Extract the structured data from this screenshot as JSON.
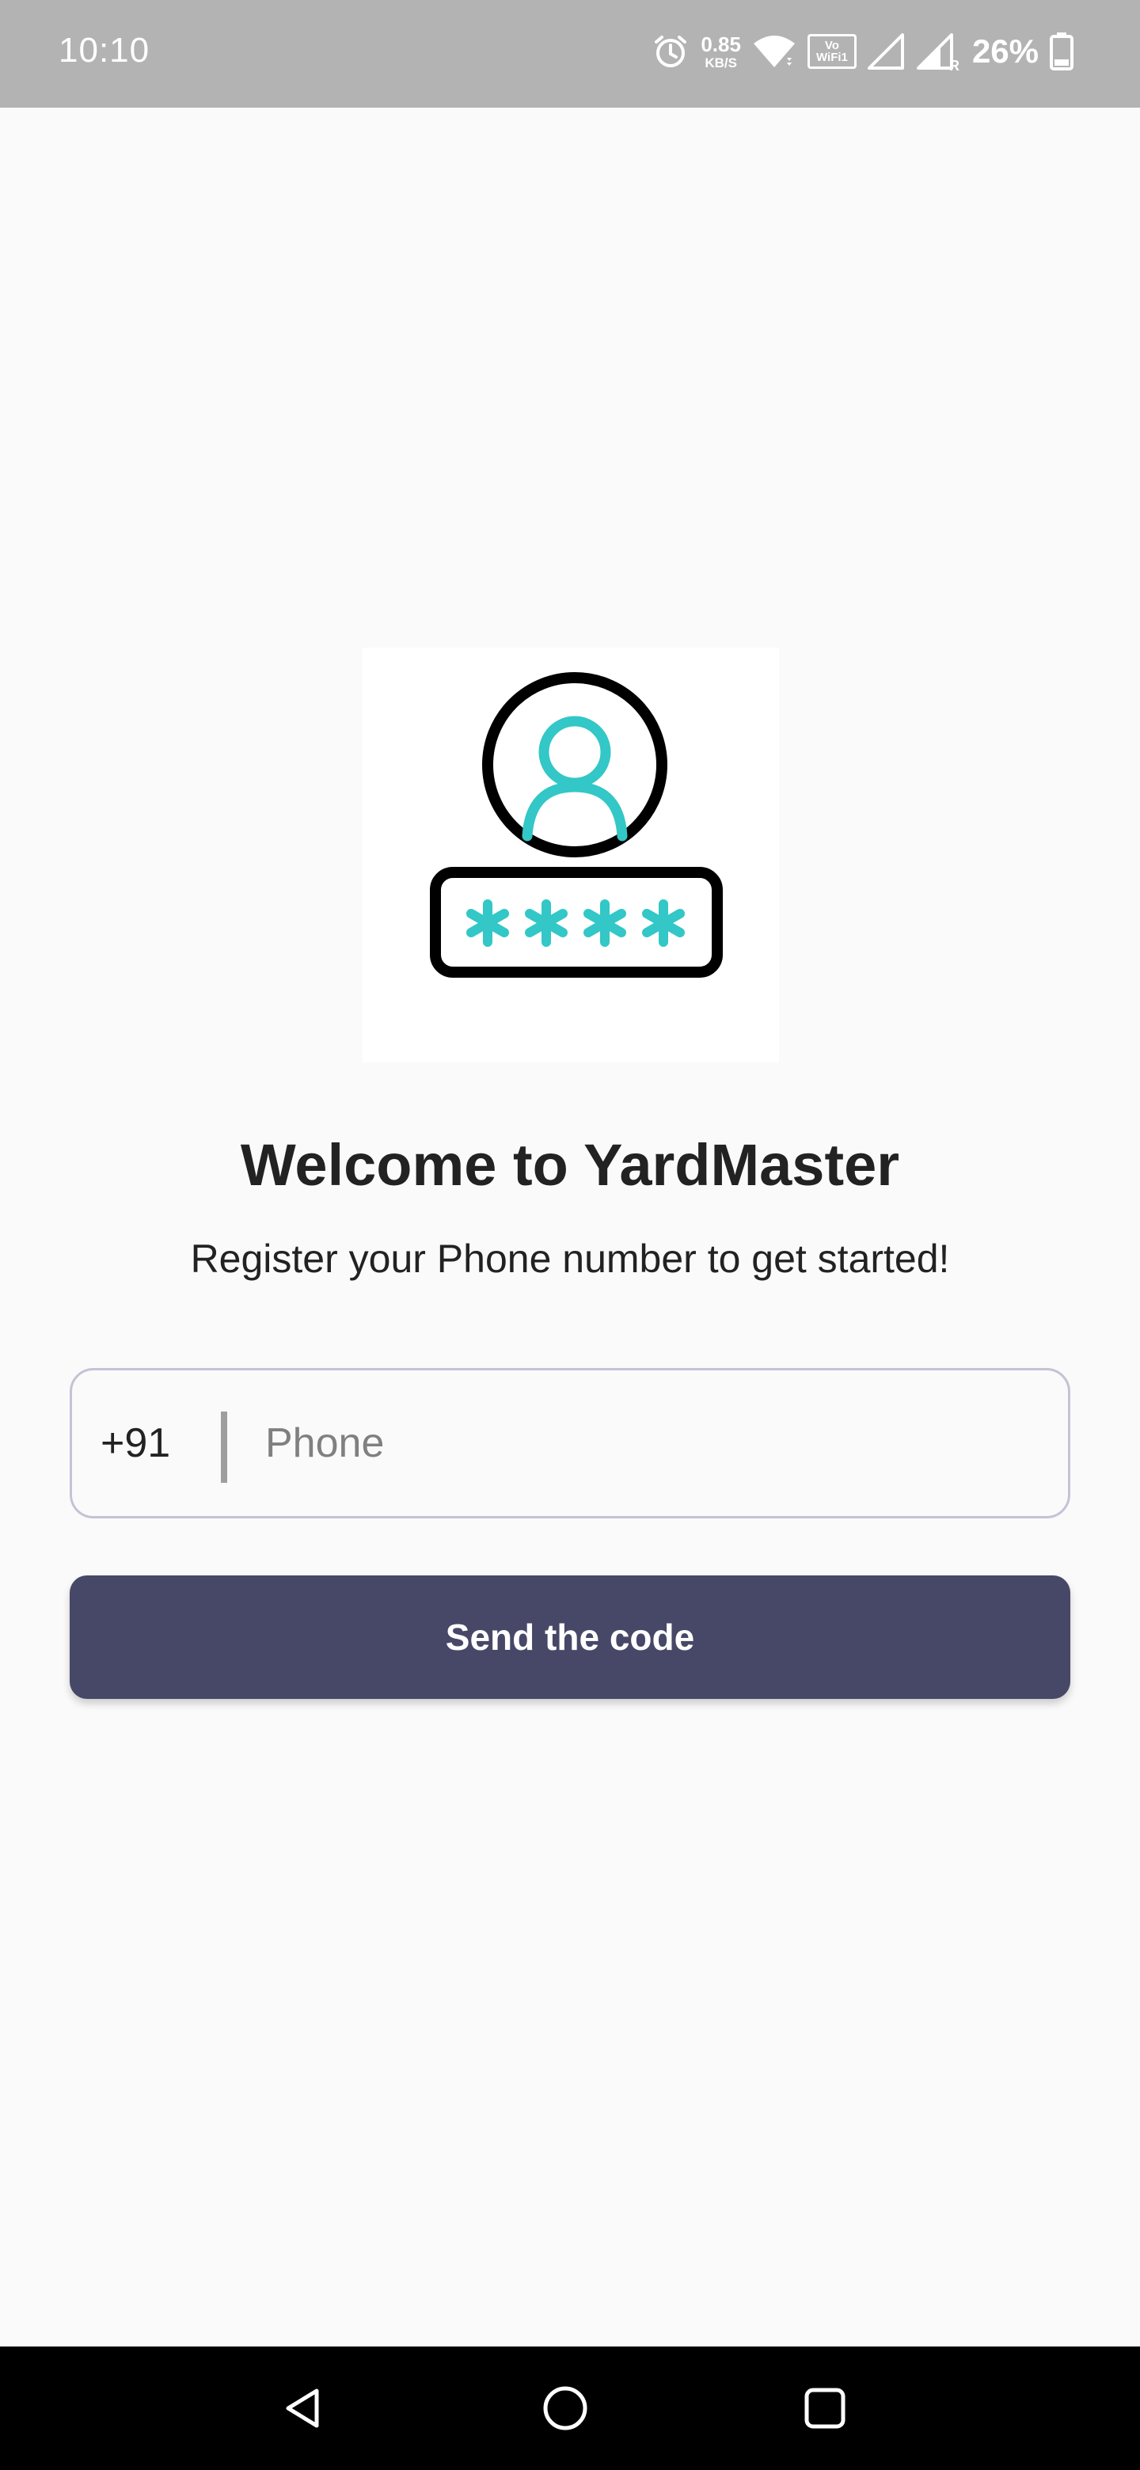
{
  "status_bar": {
    "time": "10:10",
    "net_speed_value": "0.85",
    "net_speed_unit": "KB/S",
    "volte_top": "Vo",
    "volte_bottom": "WiFi",
    "volte_sub": "1",
    "roaming_mark": "R",
    "battery_percent": "26%",
    "icons": [
      "alarm-icon",
      "wifi-icon",
      "vowifi-icon",
      "signal-icon",
      "signal-roaming-icon",
      "battery-icon"
    ]
  },
  "illustration": {
    "icon": "user-password-icon",
    "accent_color": "#33c7c7",
    "outline_color": "#000000"
  },
  "welcome": {
    "title": "Welcome to YardMaster",
    "subtitle": "Register your Phone number to get started!"
  },
  "phone_field": {
    "country_code": "+91",
    "value": "",
    "placeholder": "Phone"
  },
  "send_button": {
    "label": "Send the code",
    "color": "#474867"
  },
  "nav_bar": {
    "items": [
      "back-icon",
      "home-icon",
      "recents-icon"
    ]
  }
}
